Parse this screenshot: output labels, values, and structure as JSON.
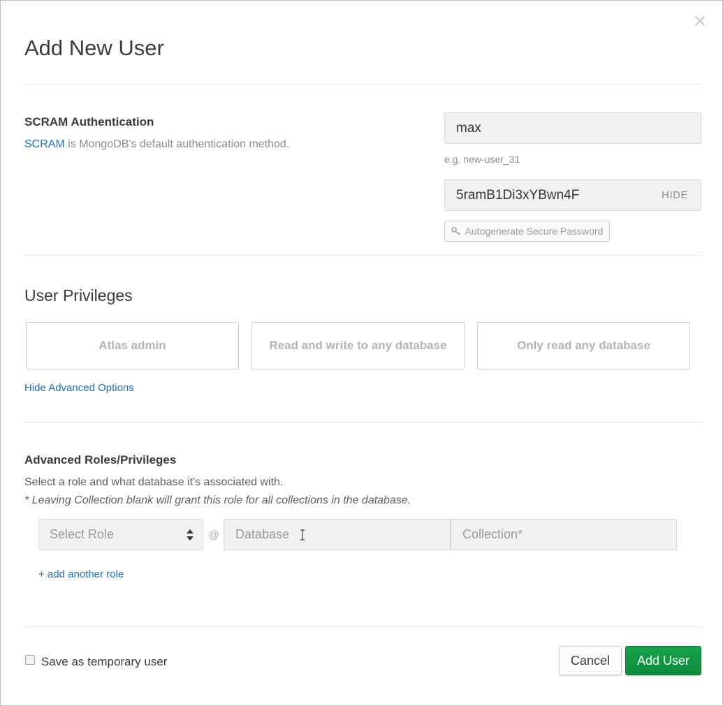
{
  "dialog": {
    "title": "Add New User",
    "close_icon": "close-icon"
  },
  "scram": {
    "heading": "SCRAM Authentication",
    "link_text": "SCRAM",
    "description_rest": " is MongoDB's default authentication method.",
    "username_value": "max",
    "username_hint": "e.g. new-user_31",
    "password_value": "5ramB1Di3xYBwn4F",
    "password_toggle_label": "HIDE",
    "autogenerate_label": "Autogenerate Secure Password",
    "autogenerate_icon": "key-icon"
  },
  "privileges": {
    "heading": "User Privileges",
    "options": [
      {
        "label": "Atlas admin"
      },
      {
        "label": "Read and write to any database"
      },
      {
        "label": "Only read any database"
      }
    ],
    "toggle_advanced_label": "Hide Advanced Options"
  },
  "advanced": {
    "heading": "Advanced Roles/Privileges",
    "description": "Select a role and what database it's associated with.",
    "note": "* Leaving Collection blank will grant this role for all collections in the database.",
    "role_select_value": "Select Role",
    "at_symbol": "@",
    "database_placeholder": "Database",
    "collection_placeholder": "Collection*",
    "add_role_label": "+ add another role"
  },
  "footer": {
    "temporary_label": "Save as temporary user",
    "temporary_checked": false,
    "cancel_label": "Cancel",
    "submit_label": "Add User"
  },
  "colors": {
    "link": "#1f6fb2",
    "primary_button": "#13aa52",
    "input_background": "#f1f1f1"
  }
}
